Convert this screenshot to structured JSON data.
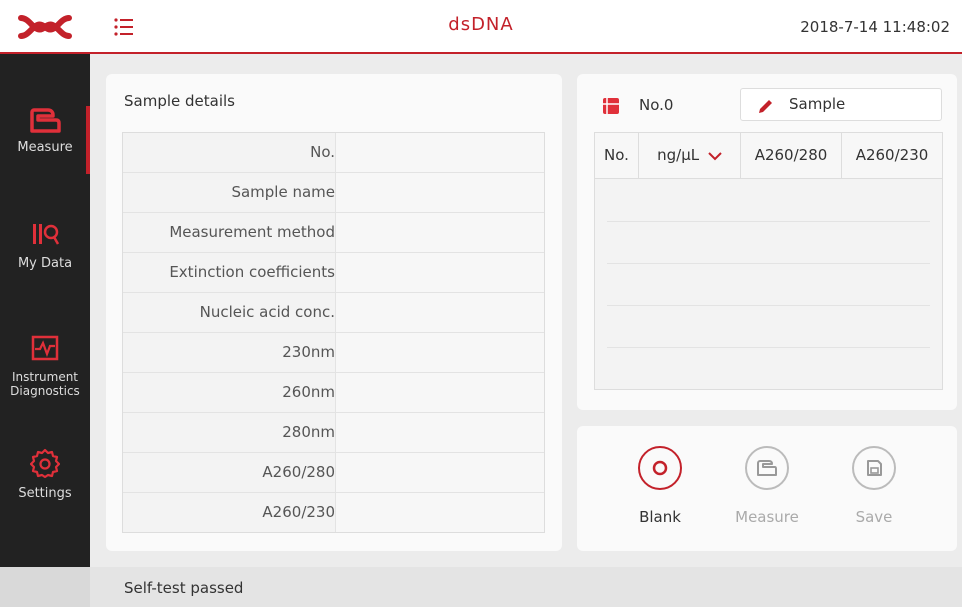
{
  "header": {
    "title": "dsDNA",
    "datetime": "2018-7-14 11:48:02",
    "accent_color": "#c3212a"
  },
  "sidebar": {
    "items": [
      {
        "label": "Measure",
        "icon": "measure-icon",
        "active": true
      },
      {
        "label": "My Data",
        "icon": "my-data-icon",
        "active": false
      },
      {
        "label": "Instrument Diagnostics",
        "icon": "diagnostics-icon",
        "active": false
      },
      {
        "label": "Settings",
        "icon": "gear-icon",
        "active": false
      }
    ]
  },
  "details": {
    "title": "Sample details",
    "rows": [
      {
        "label": "No.",
        "value": ""
      },
      {
        "label": "Sample name",
        "value": ""
      },
      {
        "label": "Measurement method",
        "value": ""
      },
      {
        "label": "Extinction coefficients",
        "value": ""
      },
      {
        "label": "Nucleic acid conc.",
        "value": ""
      },
      {
        "label": "230nm",
        "value": ""
      },
      {
        "label": "260nm",
        "value": ""
      },
      {
        "label": "280nm",
        "value": ""
      },
      {
        "label": "A260/280",
        "value": ""
      },
      {
        "label": "A260/230",
        "value": ""
      }
    ]
  },
  "results": {
    "sample_no": "No.0",
    "sample_name": "Sample",
    "columns": [
      "No.",
      "ng/µL",
      "A260/280",
      "A260/230"
    ],
    "rows": []
  },
  "actions": [
    {
      "label": "Blank",
      "icon": "blank-icon",
      "enabled": true
    },
    {
      "label": "Measure",
      "icon": "measure-icon",
      "enabled": false
    },
    {
      "label": "Save",
      "icon": "save-icon",
      "enabled": false
    }
  ],
  "status": {
    "text": "Self-test passed"
  }
}
